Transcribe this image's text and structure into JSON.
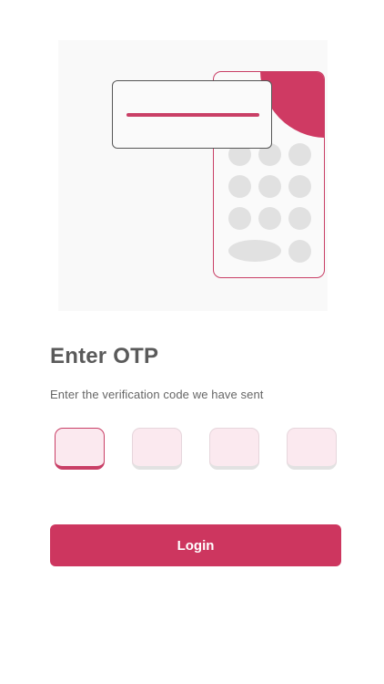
{
  "colors": {
    "accent": "#cd365f",
    "accent_light": "#fbe9ef",
    "title_text": "#5a5a5a",
    "body_text": "#666666"
  },
  "illustration": {
    "icon": "otp-phone-illustration-icon"
  },
  "header": {
    "title": "Enter OTP",
    "subtitle": "Enter the verification code we have sent"
  },
  "otp": {
    "digits": [
      "",
      "",
      "",
      ""
    ],
    "active_index": 0
  },
  "actions": {
    "login_label": "Login"
  }
}
